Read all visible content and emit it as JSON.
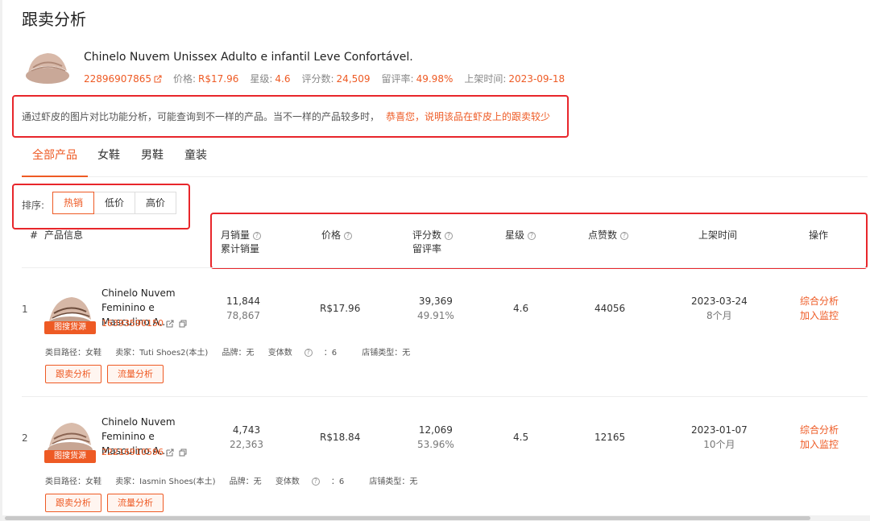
{
  "page": {
    "title": "跟卖分析"
  },
  "product": {
    "name": "Chinelo Nuvem Unissex Adulto e infantil Leve Confortável.",
    "id": "22896907865",
    "price_label": "价格:",
    "price": "R$17.96",
    "rating_label": "星级:",
    "rating": "4.6",
    "reviews_label": "评分数:",
    "reviews": "24,509",
    "review_rate_label": "留评率:",
    "review_rate": "49.98%",
    "listed_label": "上架时间:",
    "listed": "2023-09-18"
  },
  "notice": {
    "text": "通过虾皮的图片对比功能分析，可能查询到不一样的产品。当不一样的产品较多时，",
    "highlight": "恭喜您，说明该品在虾皮上的跟卖较少"
  },
  "tabs": [
    {
      "label": "全部产品",
      "active": true
    },
    {
      "label": "女鞋"
    },
    {
      "label": "男鞋"
    },
    {
      "label": "童装"
    }
  ],
  "sort": {
    "label": "排序:",
    "options": [
      {
        "label": "热销",
        "active": true
      },
      {
        "label": "低价"
      },
      {
        "label": "高价"
      }
    ]
  },
  "columns": {
    "hash": "#",
    "info": "产品信息",
    "monthly_sales": "月销量",
    "total_sales": "累计销量",
    "price": "价格",
    "reviews": "评分数",
    "review_rate": "留评率",
    "rating": "星级",
    "likes": "点赞数",
    "listed": "上架时间",
    "actions": "操作"
  },
  "rows": [
    {
      "rank": "1",
      "name": "Chinelo Nuvem Feminino e Masculino A...",
      "badge": "图搜货源",
      "id": "16393590150",
      "monthly_sales": "11,844",
      "total_sales": "78,867",
      "price": "R$17.96",
      "reviews": "39,369",
      "review_rate": "49.91%",
      "rating": "4.6",
      "likes": "44056",
      "listed_date": "2023-03-24",
      "listed_age": "8个月",
      "op1": "综合分析",
      "op2": "加入监控",
      "category": "类目路径：女鞋",
      "seller": "卖家：Tuti Shoes2(本土)",
      "brand": "品牌：无",
      "variants": "变体数",
      "variants_val": "：6",
      "shop_type": "店铺类型：无",
      "btn1": "跟卖分析",
      "btn2": "流量分析"
    },
    {
      "rank": "2",
      "name": "Chinelo Nuvem Feminino e Masculino A...",
      "badge": "图搜货源",
      "id": "22216910596",
      "monthly_sales": "4,743",
      "total_sales": "22,363",
      "price": "R$18.84",
      "reviews": "12,069",
      "review_rate": "53.96%",
      "rating": "4.5",
      "likes": "12165",
      "listed_date": "2023-01-07",
      "listed_age": "10个月",
      "op1": "综合分析",
      "op2": "加入监控",
      "category": "类目路径：女鞋",
      "seller": "卖家：Iasmin Shoes(本土)",
      "brand": "品牌：无",
      "variants": "变体数",
      "variants_val": "：6",
      "shop_type": "店铺类型：无",
      "btn1": "跟卖分析",
      "btn2": "流量分析"
    }
  ],
  "icons": {
    "external_link": "external-link-icon",
    "copy": "copy-icon",
    "help": "question-circle-icon"
  },
  "colors": {
    "accent": "#ee5a24",
    "highlight_border": "#e8262b"
  }
}
